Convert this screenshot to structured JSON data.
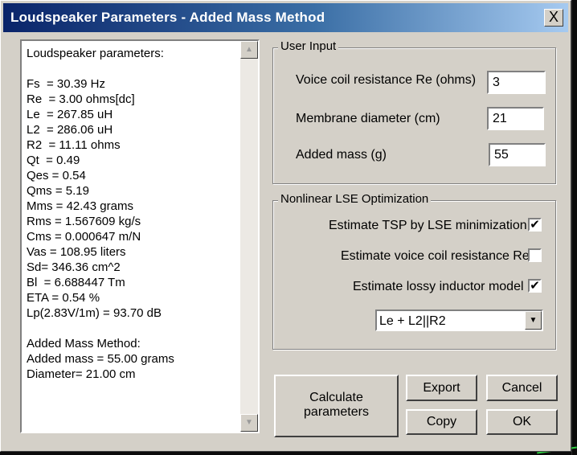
{
  "window": {
    "title": "Loudspeaker Parameters - Added Mass Method",
    "close_label": "X"
  },
  "results": {
    "lines": [
      "Loudspeaker parameters:",
      "",
      "Fs  = 30.39 Hz",
      "Re  = 3.00 ohms[dc]",
      "Le  = 267.85 uH",
      "L2  = 286.06 uH",
      "R2  = 11.11 ohms",
      "Qt  = 0.49",
      "Qes = 0.54",
      "Qms = 5.19",
      "Mms = 42.43 grams",
      "Rms = 1.567609 kg/s",
      "Cms = 0.000647 m/N",
      "Vas = 108.95 liters",
      "Sd= 346.36 cm^2",
      "Bl  = 6.688447 Tm",
      "ETA = 0.54 %",
      "Lp(2.83V/1m) = 93.70 dB",
      "",
      "Added Mass Method:",
      "Added mass = 55.00 grams",
      "Diameter= 21.00 cm"
    ]
  },
  "user_input": {
    "group_label": "User Input",
    "re_label": "Voice coil resistance Re (ohms)",
    "re_value": "3",
    "diameter_label": "Membrane diameter (cm)",
    "diameter_value": "21",
    "mass_label": "Added mass (g)",
    "mass_value": "55"
  },
  "optimization": {
    "group_label": "Nonlinear LSE Optimization",
    "tsp_label": "Estimate TSP by LSE minimization",
    "tsp_checked": true,
    "re_est_label": "Estimate voice coil resistance Re",
    "re_est_checked": false,
    "lossy_label": "Estimate lossy inductor model",
    "lossy_checked": true,
    "model_selected": "Le + L2||R2"
  },
  "buttons": {
    "calculate_line1": "Calculate",
    "calculate_line2": "parameters",
    "export": "Export",
    "cancel": "Cancel",
    "copy": "Copy",
    "ok": "OK"
  },
  "colors": {
    "title_start": "#0a246a",
    "title_end": "#a6caf0",
    "face": "#d4d0c8"
  }
}
